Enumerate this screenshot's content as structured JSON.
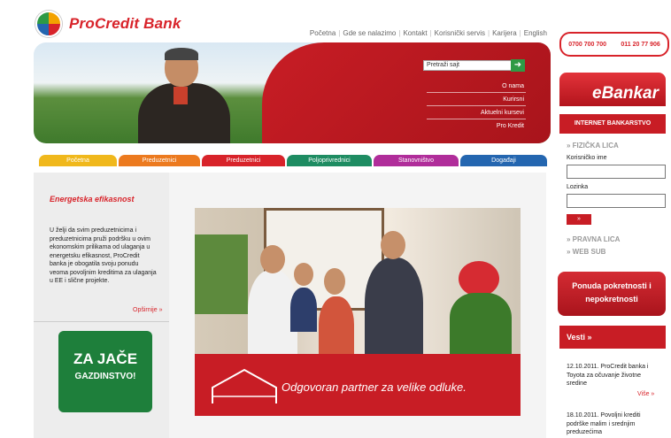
{
  "brand": {
    "name": "ProCredit Bank"
  },
  "header": {
    "links": [
      "Početna",
      "Gde se nalazimo",
      "Kontakt",
      "Korisnički servis",
      "Karijera",
      "English"
    ],
    "topright_badge": [
      "0700 700 700",
      "011 20 77 906"
    ]
  },
  "hero": {
    "search_placeholder": "Pretraži sajt",
    "search_button": "➜",
    "links": [
      "O nama",
      "Kurirsni",
      "Aktuelni kursevi",
      "Pro Kredit"
    ]
  },
  "tabs": [
    {
      "label": "Početna",
      "color": "#f0b81c"
    },
    {
      "label": "Preduzetnici",
      "color": "#ec7a1f"
    },
    {
      "label": "Preduzetnici",
      "color": "#d8232a"
    },
    {
      "label": "Poljoprivrednici",
      "color": "#1e8c62"
    },
    {
      "label": "Stanovništvo",
      "color": "#b02d9a"
    },
    {
      "label": "Događaji",
      "color": "#2466b0"
    }
  ],
  "left": {
    "title": "Energetska efikasnost",
    "text": "U želji da svim preduzetnicima i preduzetnicima pruži podršku u ovim ekonomskim prilikama od ulaganja u energetsku efikasnost, ProCredit banka je obogatila svoju ponudu veoma povoljnim kreditima za ulaganja u EE i slične projekte.",
    "more": "Opširnije »",
    "promo_line1": "ZA JAČE",
    "promo_line2": "GAZDINSTVO!"
  },
  "main": {
    "banner_text": "Odgovoran partner za velike odluke."
  },
  "right": {
    "ebank_title": "eBankar",
    "ebank_sub": "INTERNET BANKARSTVO",
    "fizicka": "» FIZIČKA LICA",
    "user_label": "Korisničko ime",
    "pass_label": "Lozinka",
    "login_button": "»",
    "pravna": "» PRAVNA LICA",
    "websub": "» WEB SUB",
    "offer": "Ponuda pokretnosti i nepokretnosti",
    "news_title": "Vesti »",
    "news": [
      {
        "text": "12.10.2011. ProCredit banka i Toyota za očuvanje životne sredine",
        "more": "Više »"
      },
      {
        "text": "18.10.2011. Povoljni krediti podrške malim i srednjim preduzećima",
        "more": ""
      }
    ]
  },
  "colors": {
    "brand_red": "#d8232a",
    "promo_green": "#1e7f3b"
  }
}
